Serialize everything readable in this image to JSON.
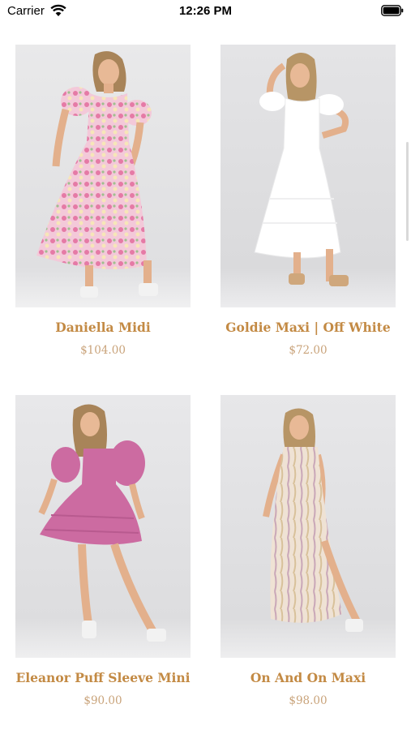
{
  "status_bar": {
    "carrier": "Carrier",
    "time": "12:26 PM",
    "wifi_icon": "wifi-icon",
    "battery_icon": "battery-icon"
  },
  "colors": {
    "accent_name": "#c38a44",
    "accent_price": "#c9a37a",
    "photo_backdrop": "#e6e6e8"
  },
  "products": [
    {
      "name": "Daniella Midi",
      "price": "$104.00",
      "dress_color": "#ee9ec2"
    },
    {
      "name": "Goldie Maxi | Off White",
      "price": "$72.00",
      "dress_color": "#ffffff"
    },
    {
      "name": "Eleanor Puff Sleeve Mini",
      "price": "$90.00",
      "dress_color": "#cc6ba1"
    },
    {
      "name": "On And On Maxi",
      "price": "$98.00",
      "dress_color": "#efe2d4"
    }
  ]
}
